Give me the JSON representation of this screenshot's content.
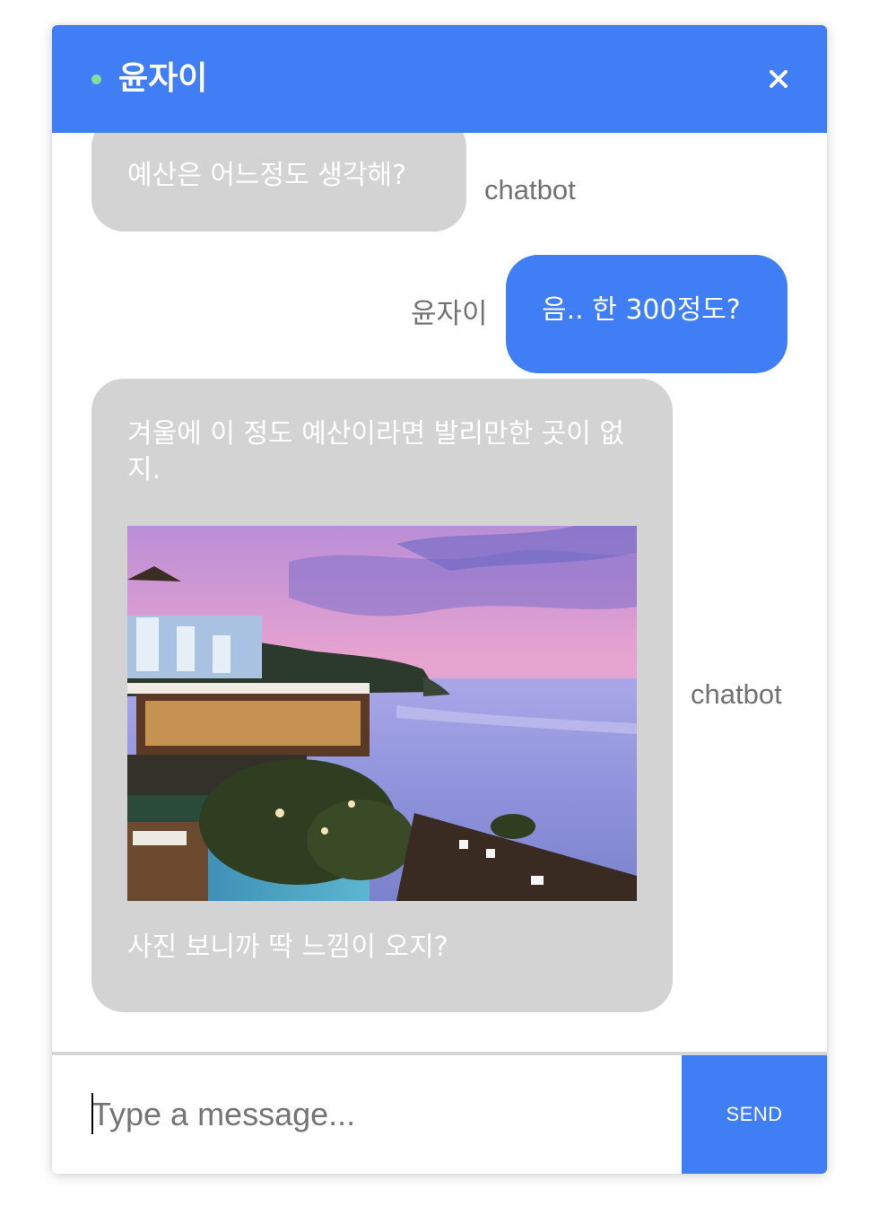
{
  "header": {
    "title": "윤자이",
    "status_color": "#7be0a0",
    "close_icon": "close-icon"
  },
  "theme": {
    "accent": "#3f7ef5",
    "bot_bubble": "#d3d3d3"
  },
  "messages": [
    {
      "sender": "chatbot",
      "role": "bot",
      "text": "예산은 어느정도 생각해?"
    },
    {
      "sender": "윤자이",
      "role": "user",
      "text": "음.. 한 300정도?"
    },
    {
      "sender": "chatbot",
      "role": "bot",
      "text": "겨울에 이 정도 예산이라면 발리만한 곳이 없지.",
      "image": "cliffside-resort-sunset-photo",
      "text_after": "사진 보니까 딱 느낌이 오지?"
    }
  ],
  "composer": {
    "placeholder": "Type a message...",
    "send_label": "SEND"
  }
}
